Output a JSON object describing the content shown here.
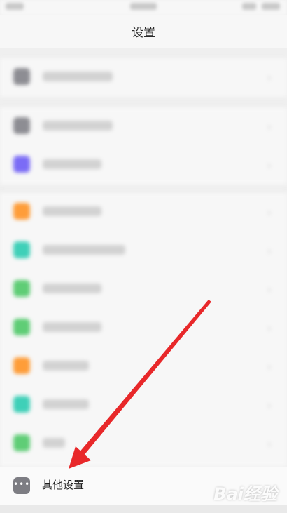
{
  "header": {
    "title": "设置"
  },
  "rows": [
    {
      "icon": "settings-icon-gray",
      "color": "#8d8d93",
      "section": 1
    },
    {
      "icon": "settings-icon-gray",
      "color": "#8d8d93",
      "section": 2
    },
    {
      "icon": "app-icon-purple",
      "color": "#7b6cf6",
      "section": 2
    },
    {
      "icon": "app-icon-orange",
      "color": "#fe9d39",
      "section": 3
    },
    {
      "icon": "app-icon-teal",
      "color": "#3fd0b8",
      "section": 3
    },
    {
      "icon": "app-icon-green",
      "color": "#5fcd76",
      "section": 3
    },
    {
      "icon": "app-icon-green",
      "color": "#5fcd76",
      "section": 3
    },
    {
      "icon": "app-icon-orange",
      "color": "#fe9d39",
      "section": 3
    },
    {
      "icon": "app-icon-teal",
      "color": "#3fd0b8",
      "section": 3
    },
    {
      "icon": "app-icon-green",
      "color": "#5fcd76",
      "section": 3
    }
  ],
  "other_settings": {
    "label": "其他设置",
    "icon": "more-dots-icon",
    "color": "#7d7d83"
  },
  "annotation": {
    "arrow_color": "#e8282a"
  },
  "watermark": {
    "text": "Bai经验"
  }
}
